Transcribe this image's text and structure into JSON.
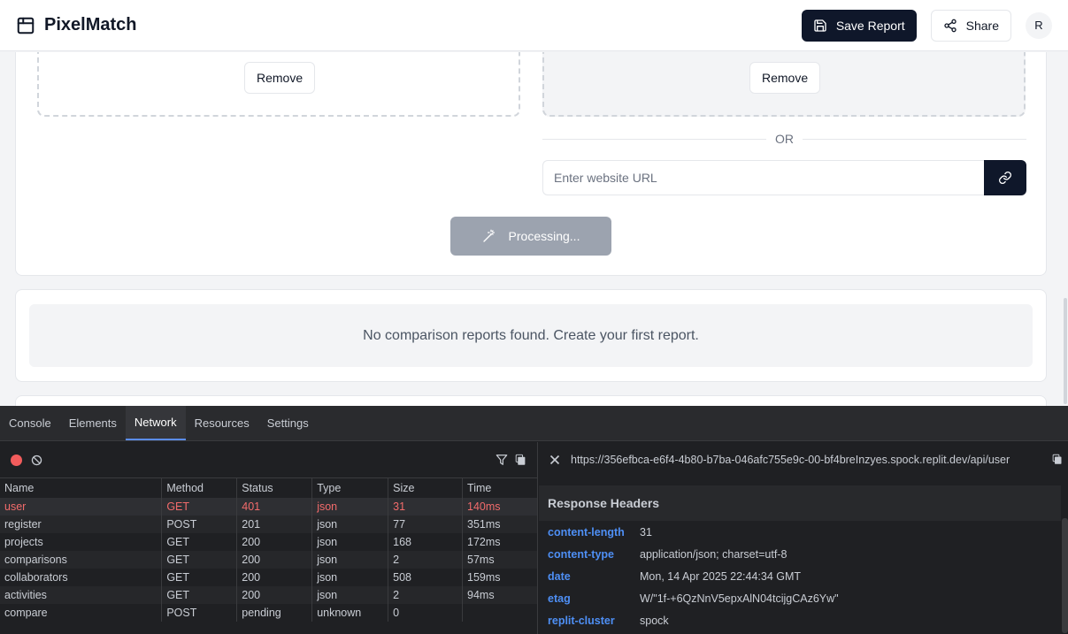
{
  "app": {
    "title": "PixelMatch"
  },
  "header": {
    "save_label": "Save Report",
    "share_label": "Share",
    "avatar_initial": "R"
  },
  "upload": {
    "remove_left": "Remove",
    "remove_right": "Remove",
    "or_text": "OR",
    "url_placeholder": "Enter website URL",
    "process_label": "Processing..."
  },
  "reports": {
    "empty_message": "No comparison reports found. Create your first report."
  },
  "devtools": {
    "tabs": [
      "Console",
      "Elements",
      "Network",
      "Resources",
      "Settings"
    ],
    "active_tab": "Network",
    "columns": [
      "Name",
      "Method",
      "Status",
      "Type",
      "Size",
      "Time"
    ],
    "requests": [
      {
        "name": "user",
        "method": "GET",
        "status": "401",
        "type": "json",
        "size": "31",
        "time": "140ms"
      },
      {
        "name": "register",
        "method": "POST",
        "status": "201",
        "type": "json",
        "size": "77",
        "time": "351ms"
      },
      {
        "name": "projects",
        "method": "GET",
        "status": "200",
        "type": "json",
        "size": "168",
        "time": "172ms"
      },
      {
        "name": "comparisons",
        "method": "GET",
        "status": "200",
        "type": "json",
        "size": "2",
        "time": "57ms"
      },
      {
        "name": "collaborators",
        "method": "GET",
        "status": "200",
        "type": "json",
        "size": "508",
        "time": "159ms"
      },
      {
        "name": "activities",
        "method": "GET",
        "status": "200",
        "type": "json",
        "size": "2",
        "time": "94ms"
      },
      {
        "name": "compare",
        "method": "POST",
        "status": "pending",
        "type": "unknown",
        "size": "0",
        "time": ""
      }
    ],
    "detail": {
      "url": "https://356efbca-e6f4-4b80-b7ba-046afc755e9c-00-bf4breInzyes.spock.replit.dev/api/user",
      "section_title": "Response Headers",
      "headers": [
        {
          "key": "content-length",
          "value": "31"
        },
        {
          "key": "content-type",
          "value": "application/json; charset=utf-8"
        },
        {
          "key": "date",
          "value": "Mon, 14 Apr 2025 22:44:34 GMT"
        },
        {
          "key": "etag",
          "value": "W/\"1f-+6QzNnV5epxAlN04tcijgCAz6Yw\""
        },
        {
          "key": "replit-cluster",
          "value": "spock"
        }
      ]
    }
  },
  "colors": {
    "accent": "#0f172a",
    "error": "#f26b6b",
    "header_key": "#4e8ff5"
  }
}
